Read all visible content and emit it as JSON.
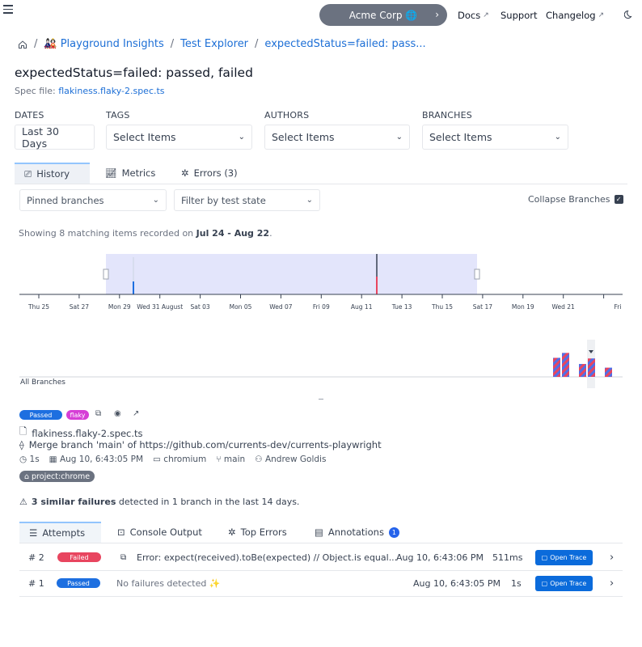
{
  "topbar": {
    "org_name": "Acme Corp 🌐",
    "docs": "Docs",
    "support": "Support",
    "changelog": "Changelog"
  },
  "breadcrumb": {
    "project": "🎎 Playground Insights",
    "explorer": "Test Explorer",
    "test": "expectedStatus=failed: pass..."
  },
  "page": {
    "title": "expectedStatus=failed: passed, failed",
    "spec_label": "Spec file:",
    "spec_file": "flakiness.flaky-2.spec.ts"
  },
  "filters": {
    "dates_label": "DATES",
    "dates_value": "Last 30 Days",
    "tags_label": "TAGS",
    "tags_value": "Select Items",
    "authors_label": "AUTHORS",
    "authors_value": "Select Items",
    "branches_label": "BRANCHES",
    "branches_value": "Select Items"
  },
  "tabs": {
    "history": "History",
    "metrics": "Metrics",
    "errors": "Errors (3)"
  },
  "history": {
    "pinned": "Pinned branches",
    "filter_state": "Filter by test state",
    "collapse": "Collapse Branches",
    "showing_prefix": "Showing 8 matching items recorded on ",
    "showing_range": "Jul 24 - Aug 22",
    "showing_suffix": ".",
    "all_branches": "All Branches"
  },
  "timeline": {
    "ticks": [
      "Thu 25",
      "Sat 27",
      "Mon 29",
      "Wed 31 August",
      "Sat 03",
      "Mon 05",
      "Wed 07",
      "Fri 09",
      "Aug 11",
      "Tue 13",
      "Thu 15",
      "Sat 17",
      "Mon 19",
      "Wed 21",
      "Fri"
    ]
  },
  "histogram": {
    "values": [
      0.62,
      0.78,
      0.42,
      0.6,
      0.3,
      0.3
    ]
  },
  "run": {
    "passed_badge": "Passed",
    "flaky_badge": "flaky",
    "file": "flakiness.flaky-2.spec.ts",
    "commit": "Merge branch 'main' of https://github.com/currents-dev/currents-playwright",
    "duration": "1s",
    "date": "Aug 10, 6:43:05 PM",
    "browser": "chromium",
    "branch": "main",
    "author": "Andrew Goldis",
    "tag": "project:chrome",
    "similar_bold": "3 similar failures",
    "similar_rest": " detected in 1 branch in the last 14 days."
  },
  "attempt_tabs": {
    "attempts": "Attempts",
    "console": "Console Output",
    "top_errors": "Top Errors",
    "annotations": "Annotations",
    "annotations_count": "1"
  },
  "attempts": [
    {
      "num": "# 2",
      "status": "Failed",
      "message": "Error: expect(received).toBe(expected) // Object.is equal...",
      "date": "Aug 10, 6:43:06 PM",
      "duration": "511ms",
      "trace": "Open Trace"
    },
    {
      "num": "# 1",
      "status": "Passed",
      "message": "No failures detected ✨",
      "date": "Aug 10, 6:43:05 PM",
      "duration": "1s",
      "trace": "Open Trace"
    }
  ],
  "colors": {
    "passed": "#1d6fe0",
    "failed": "#e8455f",
    "flaky": "#d63fd6",
    "accent": "#1d6fd6",
    "selection": "#e3e5fb"
  }
}
